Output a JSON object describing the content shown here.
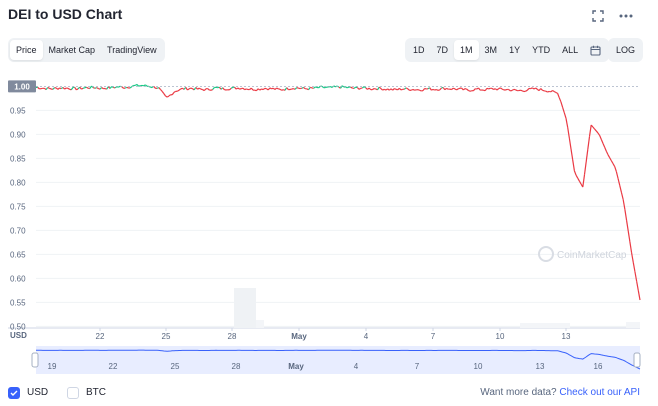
{
  "header": {
    "title": "DEI to USD Chart",
    "icons": [
      "expand-icon",
      "more-icon"
    ]
  },
  "tabs": [
    {
      "label": "Price",
      "active": true
    },
    {
      "label": "Market Cap",
      "active": false
    },
    {
      "label": "TradingView",
      "active": false
    }
  ],
  "ranges": [
    {
      "label": "1D",
      "active": false
    },
    {
      "label": "7D",
      "active": false
    },
    {
      "label": "1M",
      "active": true
    },
    {
      "label": "3M",
      "active": false
    },
    {
      "label": "1Y",
      "active": false
    },
    {
      "label": "YTD",
      "active": false
    },
    {
      "label": "ALL",
      "active": false
    }
  ],
  "log_label": "LOG",
  "chart_data": {
    "type": "line",
    "xlabel": "USD",
    "x_ticks": [
      "22",
      "25",
      "28",
      "May",
      "4",
      "7",
      "10",
      "13"
    ],
    "navigator_ticks": [
      "19",
      "22",
      "25",
      "28",
      "May",
      "4",
      "7",
      "10",
      "13",
      "16"
    ],
    "y_ticks": [
      "0.95",
      "0.90",
      "0.85",
      "0.80",
      "0.75",
      "0.70",
      "0.65",
      "0.60",
      "0.55",
      "0.50"
    ],
    "current_price_label": "1.00",
    "ylim": [
      0.48,
      1.005
    ],
    "series": [
      {
        "values": [
          0.998,
          0.996,
          0.995,
          0.997,
          0.996,
          0.995,
          0.997,
          0.998,
          0.996,
          0.997,
          0.999,
          0.998,
          1.001,
          1.002,
          1.0,
          0.997,
          0.975,
          0.99,
          0.995,
          0.996,
          0.994,
          0.993,
          0.997,
          0.995,
          0.996,
          0.997,
          0.995,
          0.994,
          0.996,
          0.995,
          0.993,
          0.996,
          0.997,
          0.995,
          0.996,
          0.998,
          0.997,
          0.999,
          0.998,
          0.996,
          0.997,
          0.995,
          0.996,
          0.994,
          0.993,
          0.995,
          0.994,
          0.993,
          0.995,
          0.994,
          0.996,
          0.995,
          0.994,
          0.992,
          0.994,
          0.993,
          0.995,
          0.994,
          0.993,
          0.991,
          0.992,
          0.995,
          0.993,
          0.99,
          0.985,
          0.93,
          0.82,
          0.79,
          0.92,
          0.9,
          0.86,
          0.83,
          0.76,
          0.65,
          0.555
        ]
      }
    ],
    "up_color": "#16c784",
    "down_color": "#ea3943",
    "navigator_color": "#3861fb",
    "watermark": "CoinMarketCap"
  },
  "footer": {
    "currencies": [
      {
        "label": "USD",
        "checked": true
      },
      {
        "label": "BTC",
        "checked": false
      }
    ],
    "api_text": "Want more data?",
    "api_link": "Check out our API"
  }
}
